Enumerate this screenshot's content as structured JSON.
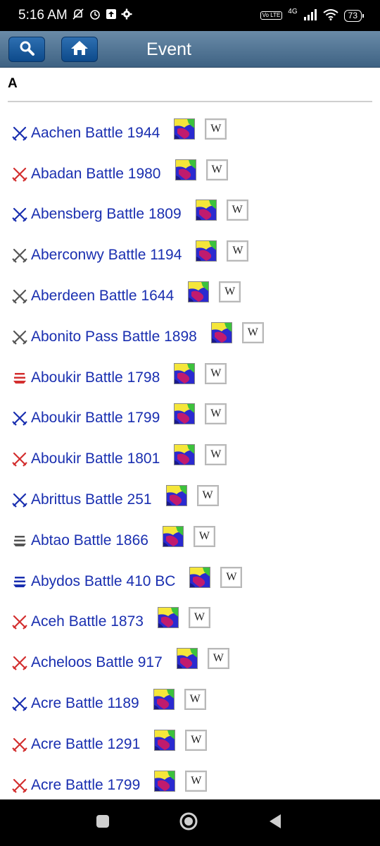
{
  "status_bar": {
    "time": "5:16 AM",
    "network": "4G",
    "volte": "Vo LTE",
    "battery": "73"
  },
  "app_bar": {
    "title": "Event"
  },
  "section": {
    "letter": "A"
  },
  "events": [
    {
      "name": "Aachen Battle 1944",
      "icon": "crossed-swords-icon",
      "color": "#1a2fb0"
    },
    {
      "name": "Abadan Battle 1980",
      "icon": "crossed-swords-icon",
      "color": "#d32f2f"
    },
    {
      "name": "Abensberg Battle 1809",
      "icon": "crossed-swords-icon",
      "color": "#1a2fb0"
    },
    {
      "name": "Aberconwy Battle 1194",
      "icon": "crossed-swords-icon",
      "color": "#555555"
    },
    {
      "name": "Aberdeen Battle 1644",
      "icon": "crossed-swords-icon",
      "color": "#555555"
    },
    {
      "name": "Abonito Pass Battle 1898",
      "icon": "crossed-swords-icon",
      "color": "#555555"
    },
    {
      "name": "Aboukir Battle 1798",
      "icon": "naval-ship-icon",
      "color": "#d32f2f"
    },
    {
      "name": "Aboukir Battle 1799",
      "icon": "crossed-swords-icon",
      "color": "#1a2fb0"
    },
    {
      "name": "Aboukir Battle 1801",
      "icon": "crossed-swords-icon",
      "color": "#d32f2f"
    },
    {
      "name": "Abrittus Battle 251",
      "icon": "crossed-swords-icon",
      "color": "#1a2fb0"
    },
    {
      "name": "Abtao Battle 1866",
      "icon": "naval-ship-icon",
      "color": "#555555"
    },
    {
      "name": "Abydos Battle 410 BC",
      "icon": "naval-ship-icon",
      "color": "#1a2fb0"
    },
    {
      "name": "Aceh Battle 1873",
      "icon": "crossed-swords-icon",
      "color": "#d32f2f"
    },
    {
      "name": "Acheloos Battle 917",
      "icon": "crossed-swords-icon",
      "color": "#d32f2f"
    },
    {
      "name": "Acre Battle 1189",
      "icon": "crossed-swords-icon",
      "color": "#1a2fb0"
    },
    {
      "name": "Acre Battle 1291",
      "icon": "crossed-swords-icon",
      "color": "#d32f2f"
    },
    {
      "name": "Acre Battle 1799",
      "icon": "crossed-swords-icon",
      "color": "#d32f2f"
    }
  ],
  "wiki_label": "W"
}
